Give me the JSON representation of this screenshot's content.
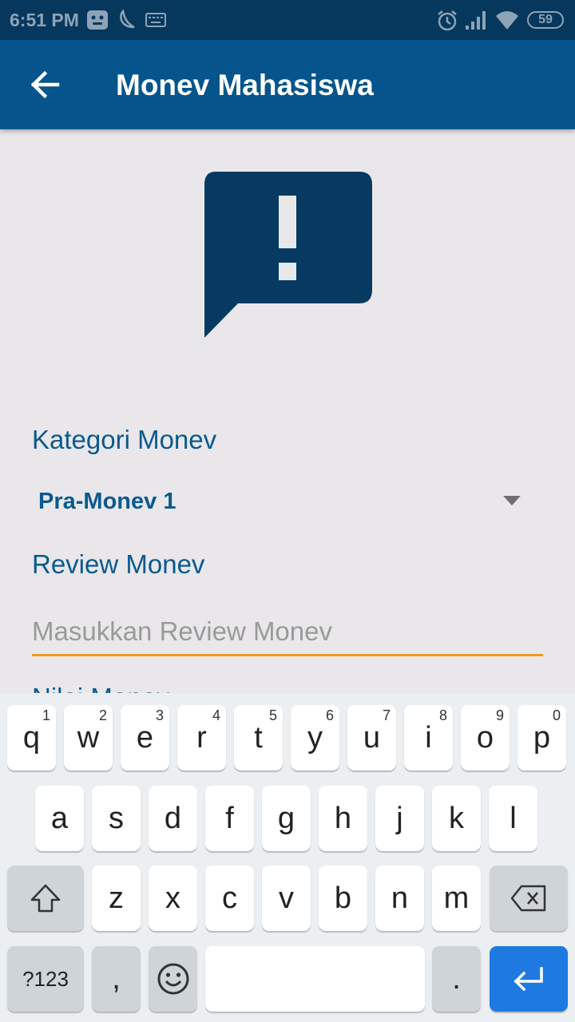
{
  "status_bar": {
    "time": "6:51 PM",
    "battery": "59",
    "icons": [
      "notification-app-icon",
      "moon-icon",
      "keyboard-icon",
      "alarm-icon",
      "signal-icon",
      "wifi-icon",
      "battery-icon"
    ]
  },
  "app_bar": {
    "title": "Monev Mahasiswa",
    "back_icon": "arrow-back-icon"
  },
  "illustration": {
    "icon": "feedback-alert-icon",
    "color": "#073a60"
  },
  "form": {
    "kategori_label": "Kategori Monev",
    "kategori_value": "Pra-Monev 1",
    "review_label": "Review Monev",
    "review_placeholder": "Masukkan Review Monev",
    "review_value": "",
    "nilai_label": "Nilai Monev"
  },
  "keyboard": {
    "row1": [
      {
        "letter": "q",
        "num": "1"
      },
      {
        "letter": "w",
        "num": "2"
      },
      {
        "letter": "e",
        "num": "3"
      },
      {
        "letter": "r",
        "num": "4"
      },
      {
        "letter": "t",
        "num": "5"
      },
      {
        "letter": "y",
        "num": "6"
      },
      {
        "letter": "u",
        "num": "7"
      },
      {
        "letter": "i",
        "num": "8"
      },
      {
        "letter": "o",
        "num": "9"
      },
      {
        "letter": "p",
        "num": "0"
      }
    ],
    "row2": [
      "a",
      "s",
      "d",
      "f",
      "g",
      "h",
      "j",
      "k",
      "l"
    ],
    "row3": [
      "z",
      "x",
      "c",
      "v",
      "b",
      "n",
      "m"
    ],
    "symbols_label": "?123",
    "comma": ",",
    "period": "."
  },
  "colors": {
    "status_bar": "#06385d",
    "app_bar": "#05558c",
    "accent_text": "#0a5a8e",
    "input_underline": "#f09a1a",
    "enter_key": "#1e7ae0"
  }
}
